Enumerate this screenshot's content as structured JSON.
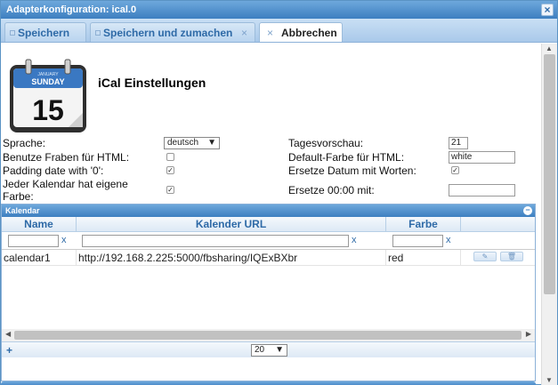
{
  "window": {
    "title": "Adapterkonfiguration: ical.0",
    "close": "×"
  },
  "tabs": [
    {
      "label": "Speichern",
      "close": ""
    },
    {
      "label": "Speichern und zumachen",
      "close": "×"
    },
    {
      "label": "Abbrechen",
      "close": "×"
    }
  ],
  "header": {
    "title": "iCal Einstellungen",
    "icon": {
      "month": "JANUARY",
      "weekday": "SUNDAY",
      "day": "15"
    }
  },
  "settings": {
    "sprache_label": "Sprache:",
    "sprache_value": "deutsch",
    "sprache_arrow": "▼",
    "farben_label": "Benutze Fraben für HTML:",
    "farben_checked": "",
    "padding_label": "Padding date with '0':",
    "padding_checked": "✓",
    "jeder_label": "Jeder Kalendar hat eigene Farbe:",
    "jeder_checked": "✓",
    "vorschau_label": "Tagesvorschau:",
    "vorschau_value": "21",
    "default_farbe_label": "Default-Farbe für HTML:",
    "default_farbe_value": "white",
    "ersetze_datum_label": "Ersetze Datum mit Worten:",
    "ersetze_datum_checked": "✓",
    "ersetze_00_label": "Ersetze 00:00 mit:",
    "ersetze_00_value": ""
  },
  "grid": {
    "caption": "Kalendar",
    "collapse": "−",
    "columns": [
      "Name",
      "Kalender URL",
      "Farbe",
      ""
    ],
    "filter_clear": "x",
    "rows": [
      {
        "name": "calendar1",
        "url": "http://192.168.2.225:5000/fbsharing/IQExBXbr",
        "color": "red",
        "edit": "✎",
        "delete": "🗑"
      }
    ],
    "pager": {
      "add": "+",
      "page_size": "20",
      "arrow": "▼"
    }
  },
  "scroll": {
    "up": "▲",
    "down": "▼",
    "left": "◀",
    "right": "▶"
  }
}
